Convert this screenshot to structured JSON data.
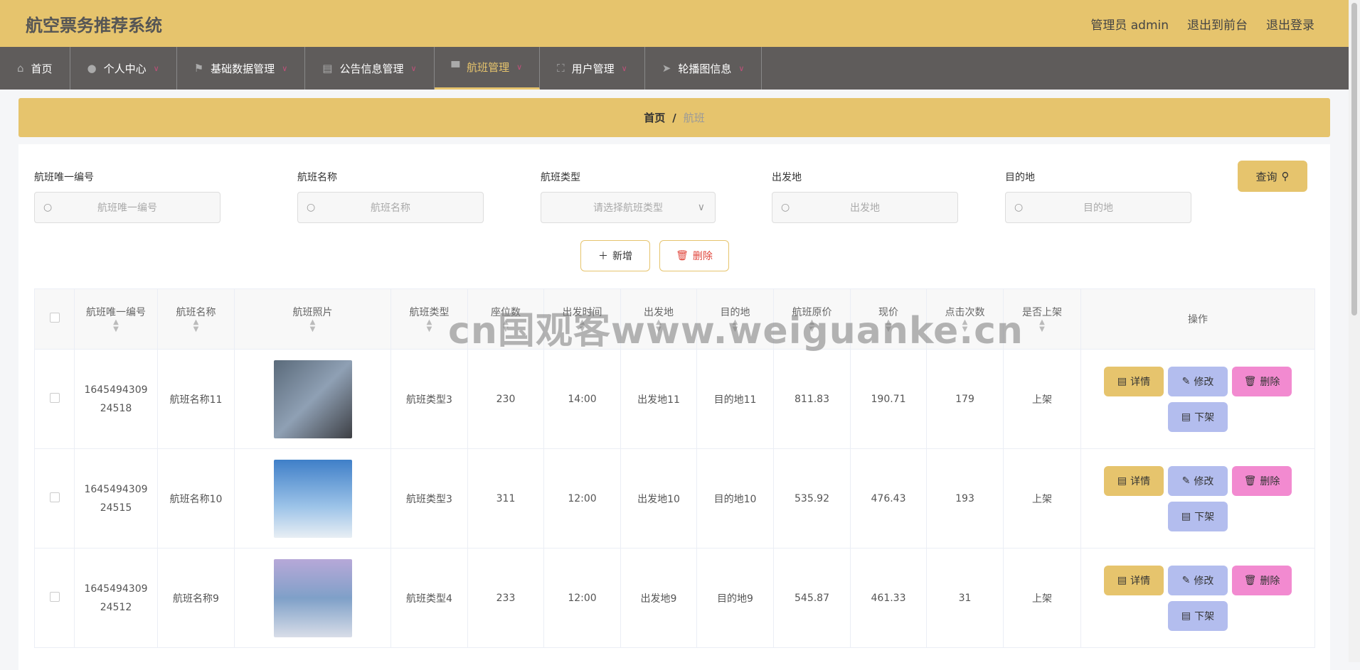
{
  "header": {
    "title": "航空票务推荐系统",
    "admin": "管理员 admin",
    "front": "退出到前台",
    "logout": "退出登录"
  },
  "nav": [
    {
      "label": "首页",
      "icon": "home-icon"
    },
    {
      "label": "个人中心",
      "icon": "user-icon"
    },
    {
      "label": "基础数据管理",
      "icon": "flag-icon"
    },
    {
      "label": "公告信息管理",
      "icon": "clipboard-icon"
    },
    {
      "label": "航班管理",
      "icon": "plane-seat-icon",
      "active": true
    },
    {
      "label": "用户管理",
      "icon": "frame-icon"
    },
    {
      "label": "轮播图信息",
      "icon": "send-icon"
    }
  ],
  "breadcrumb": {
    "home": "首页",
    "sep": "/",
    "current": "航班"
  },
  "filters": [
    {
      "label": "航班唯一编号",
      "placeholder": "航班唯一编号"
    },
    {
      "label": "航班名称",
      "placeholder": "航班名称"
    },
    {
      "label": "航班类型",
      "placeholder": "请选择航班类型"
    },
    {
      "label": "出发地",
      "placeholder": "出发地"
    },
    {
      "label": "目的地",
      "placeholder": "目的地"
    }
  ],
  "buttons": {
    "query": "查询",
    "add": "新增",
    "delete": "删除"
  },
  "columns": [
    "航班唯一编号",
    "航班名称",
    "航班照片",
    "航班类型",
    "座位数",
    "出发时间",
    "出发地",
    "目的地",
    "航班原价",
    "现价",
    "点击次数",
    "是否上架",
    "操作"
  ],
  "rows": [
    {
      "id": "1645494309\n24518",
      "name": "航班名称11",
      "type": "航班类型3",
      "seats": "230",
      "time": "14:00",
      "from": "出发地11",
      "to": "目的地11",
      "orig": "811.83",
      "price": "190.71",
      "clicks": "179",
      "status": "上架"
    },
    {
      "id": "1645494309\n24515",
      "name": "航班名称10",
      "type": "航班类型3",
      "seats": "311",
      "time": "12:00",
      "from": "出发地10",
      "to": "目的地10",
      "orig": "535.92",
      "price": "476.43",
      "clicks": "193",
      "status": "上架"
    },
    {
      "id": "1645494309\n24512",
      "name": "航班名称9",
      "type": "航班类型4",
      "seats": "233",
      "time": "12:00",
      "from": "出发地9",
      "to": "目的地9",
      "orig": "545.87",
      "price": "461.33",
      "clicks": "31",
      "status": "上架"
    }
  ],
  "actions": {
    "detail": "详情",
    "edit": "修改",
    "delete": "删除",
    "offshelf": "下架"
  },
  "watermark": "cn国观客www.weiguanke.cn"
}
